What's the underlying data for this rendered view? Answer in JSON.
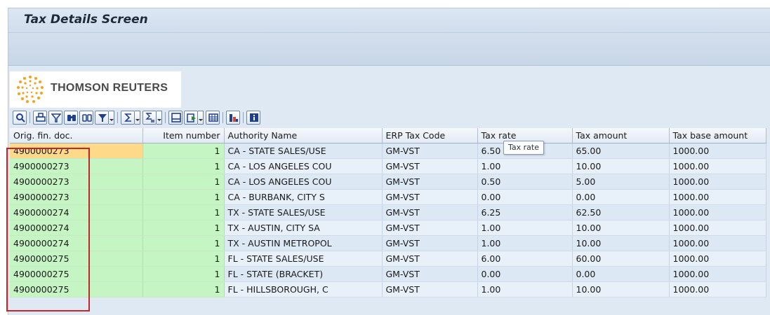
{
  "screen": {
    "title": "Tax Details Screen"
  },
  "logo": {
    "text": "THOMSON REUTERS"
  },
  "toolbar": {
    "icons": [
      "details-icon",
      "print-icon",
      "filter-icon",
      "find-icon",
      "find-next-icon",
      "set-filter-icon",
      "sum-icon",
      "subtotal-icon",
      "print-preview-icon",
      "export-icon",
      "layout-icon",
      "abc-analysis-icon",
      "information-icon"
    ]
  },
  "tooltip": {
    "text": "Tax rate"
  },
  "table": {
    "columns": [
      "Orig. fin. doc.",
      "Item number",
      "Authority Name",
      "ERP Tax Code",
      "Tax rate",
      "Tax amount",
      "Tax base amount"
    ],
    "rows": [
      [
        "4900000273",
        "1",
        "CA - STATE SALES/USE",
        "GM-VST",
        "6.50",
        "65.00",
        "1000.00"
      ],
      [
        "4900000273",
        "1",
        "CA - LOS ANGELES COU",
        "GM-VST",
        "1.00",
        "10.00",
        "1000.00"
      ],
      [
        "4900000273",
        "1",
        "CA - LOS ANGELES COU",
        "GM-VST",
        "0.50",
        "5.00",
        "1000.00"
      ],
      [
        "4900000273",
        "1",
        "CA - BURBANK, CITY S",
        "GM-VST",
        "0.00",
        "0.00",
        "1000.00"
      ],
      [
        "4900000274",
        "1",
        "TX - STATE SALES/USE",
        "GM-VST",
        "6.25",
        "62.50",
        "1000.00"
      ],
      [
        "4900000274",
        "1",
        "TX - AUSTIN, CITY SA",
        "GM-VST",
        "1.00",
        "10.00",
        "1000.00"
      ],
      [
        "4900000274",
        "1",
        "TX - AUSTIN METROPOL",
        "GM-VST",
        "1.00",
        "10.00",
        "1000.00"
      ],
      [
        "4900000275",
        "1",
        "FL - STATE SALES/USE",
        "GM-VST",
        "6.00",
        "60.00",
        "1000.00"
      ],
      [
        "4900000275",
        "1",
        "FL - STATE (BRACKET)",
        "GM-VST",
        "0.00",
        "0.00",
        "1000.00"
      ],
      [
        "4900000275",
        "1",
        "FL - HILLSBOROUGH, C",
        "GM-VST",
        "1.00",
        "10.00",
        "1000.00"
      ]
    ]
  },
  "colors": {
    "key_cell": "#c5f5c2",
    "selected_cell": "#ffd98a",
    "highlight_box": "#c0272d",
    "logo_orange": "#f5a21b"
  }
}
